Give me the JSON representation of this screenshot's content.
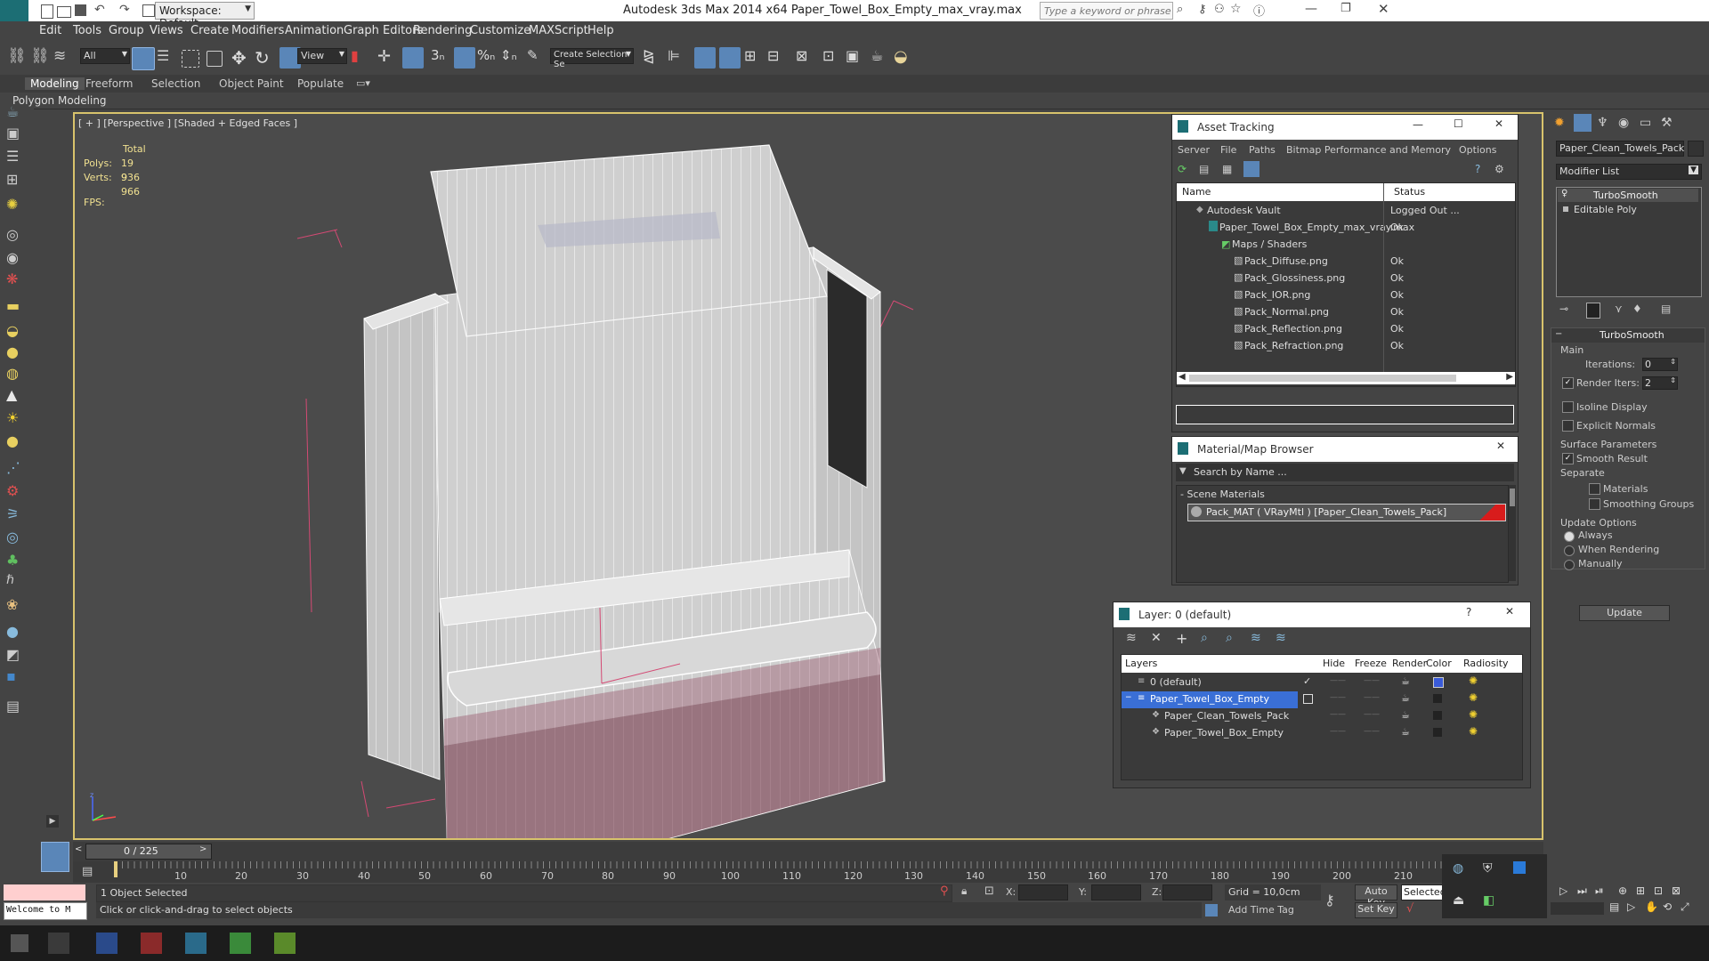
{
  "app": {
    "title": "Autodesk 3ds Max  2014 x64    Paper_Towel_Box_Empty_max_vray.max",
    "workspace": "Workspace: Default",
    "search_placeholder": "Type a keyword or phrase"
  },
  "menu": [
    "Edit",
    "Tools",
    "Group",
    "Views",
    "Create",
    "Modifiers",
    "Animation",
    "Graph Editors",
    "Rendering",
    "Customize",
    "MAXScript",
    "Help"
  ],
  "toolbar": {
    "filter": "All",
    "view": "View",
    "selection_set": "Create Selection Se"
  },
  "ribbon": {
    "tabs": [
      "Modeling",
      "Freeform",
      "Selection",
      "Object Paint",
      "Populate"
    ],
    "sub": "Polygon Modeling"
  },
  "viewport": {
    "label": "[ + ] [Perspective ] [Shaded + Edged Faces ]",
    "stats": {
      "total": "Total",
      "polys_label": "Polys:",
      "polys": "19 936",
      "verts_label": "Verts:",
      "verts": "9 966",
      "fps_label": "FPS:"
    }
  },
  "asset_tracking": {
    "title": "Asset Tracking",
    "menu": [
      "Server",
      "File",
      "Paths",
      "Bitmap Performance and Memory",
      "Options"
    ],
    "columns": [
      "Name",
      "Status"
    ],
    "rows": [
      {
        "name": "Autodesk Vault",
        "status": "Logged Out ..."
      },
      {
        "name": "Paper_Towel_Box_Empty_max_vray.max",
        "status": "Ok"
      },
      {
        "name": "Maps / Shaders",
        "status": ""
      },
      {
        "name": "Pack_Diffuse.png",
        "status": "Ok"
      },
      {
        "name": "Pack_Glossiness.png",
        "status": "Ok"
      },
      {
        "name": "Pack_IOR.png",
        "status": "Ok"
      },
      {
        "name": "Pack_Normal.png",
        "status": "Ok"
      },
      {
        "name": "Pack_Reflection.png",
        "status": "Ok"
      },
      {
        "name": "Pack_Refraction.png",
        "status": "Ok"
      }
    ]
  },
  "material_browser": {
    "title": "Material/Map Browser",
    "search_placeholder": "Search by Name ...",
    "section": "- Scene Materials",
    "material": "Pack_MAT  ( VRayMtl )  [Paper_Clean_Towels_Pack]"
  },
  "layer_manager": {
    "title": "Layer: 0 (default)",
    "columns": [
      "Layers",
      "Hide",
      "Freeze",
      "Render",
      "Color",
      "Radiosity"
    ],
    "rows": [
      {
        "name": "0 (default)",
        "color": "#3a5bd9"
      },
      {
        "name": "Paper_Towel_Box_Empty",
        "color": "#222222"
      },
      {
        "name": "Paper_Clean_Towels_Pack",
        "color": "#222222"
      },
      {
        "name": "Paper_Towel_Box_Empty",
        "color": "#222222"
      }
    ]
  },
  "command_panel": {
    "object_name": "Paper_Clean_Towels_Pack",
    "modifier_list": "Modifier List",
    "stack": [
      "TurboSmooth",
      "Editable Poly"
    ],
    "rollout_title": "TurboSmooth",
    "main": "Main",
    "iterations_label": "Iterations:",
    "iterations": "0",
    "render_iters_label": "Render Iters:",
    "render_iters": "2",
    "isoline": "Isoline Display",
    "explicit": "Explicit Normals",
    "surface": "Surface Parameters",
    "smooth_result": "Smooth Result",
    "separate": "Separate",
    "materials": "Materials",
    "smoothing_groups": "Smoothing Groups",
    "update_options": "Update Options",
    "always": "Always",
    "when_rendering": "When Rendering",
    "manually": "Manually",
    "update": "Update"
  },
  "timeline": {
    "frame": "0 / 225",
    "ticks": [
      "10",
      "20",
      "30",
      "40",
      "50",
      "60",
      "70",
      "80",
      "90",
      "100",
      "110",
      "120",
      "130",
      "140",
      "150",
      "160",
      "170",
      "180",
      "190",
      "200",
      "210"
    ]
  },
  "status": {
    "selected": "1 Object Selected",
    "prompt": "Click or click-and-drag to select objects",
    "welcome": "Welcome to M",
    "x": "X:",
    "y": "Y:",
    "z": "Z:",
    "grid": "Grid = 10,0cm",
    "add_time_tag": "Add Time Tag",
    "auto_key": "Auto Key",
    "set_key": "Set Key",
    "selected_dropdown": "Selected"
  }
}
